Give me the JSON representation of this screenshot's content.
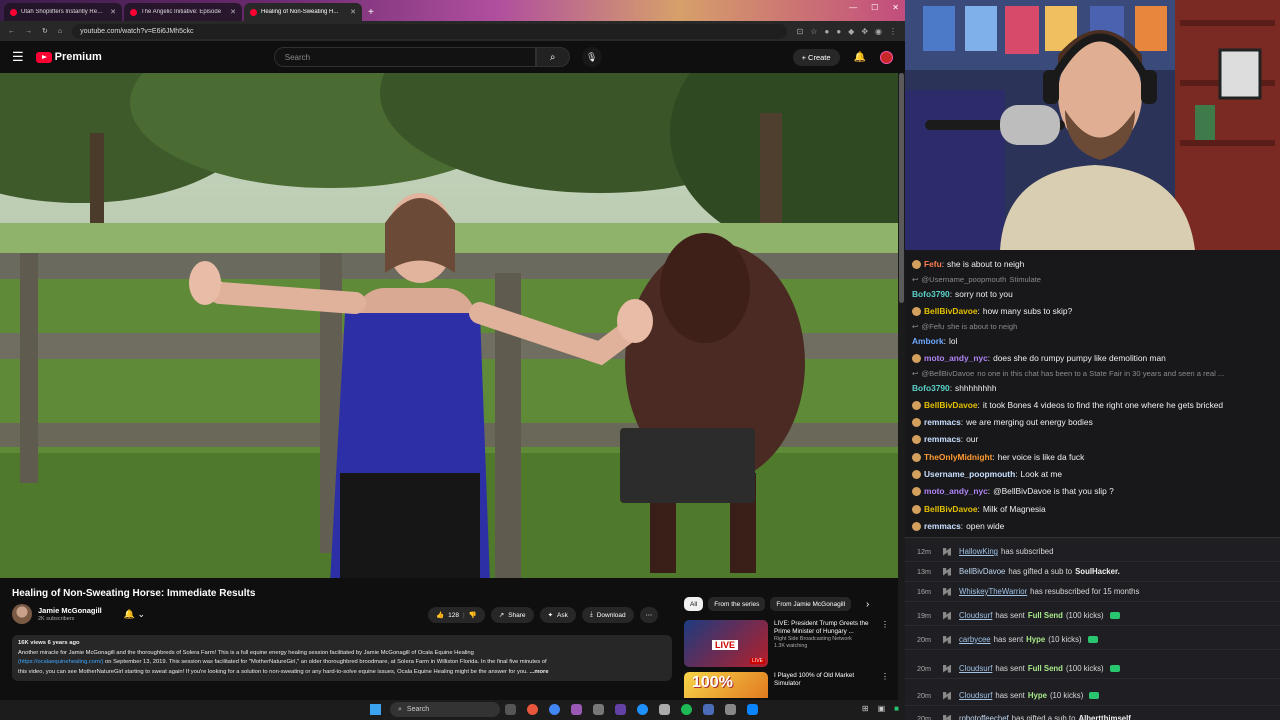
{
  "browser": {
    "tabs": [
      {
        "title": "Utah Shoplifters Instantly Regr...",
        "active": false
      },
      {
        "title": "The Angelic Initiative: Episode",
        "active": false
      },
      {
        "title": "Healing of Non-Sweating H...",
        "active": true
      }
    ],
    "url": "youtube.com/watch?v=E6i6JMh5ckc"
  },
  "youtube": {
    "logo_text": "Premium",
    "search_placeholder": "Search",
    "create_label": "Create",
    "video_title": "Healing of Non-Sweating Horse: Immediate Results",
    "channel_name": "Jamie McGonagill",
    "channel_subs": "2K subscribers",
    "likes": "128",
    "share_label": "Share",
    "ask_label": "Ask",
    "download_label": "Download",
    "description": {
      "meta": "16K views  6 years ago",
      "line1": "Another miracle for Jamie McGonagill and the thoroughbreds of Solera Farm! This is a full equine energy healing session facilitated by Jamie McGonagill of Ocala Equine Healing",
      "link": "(https://ocalaequinehealing.com/)",
      "line2": " on September 13, 2019. This session was facilitated for \"MotherNatureGirl,\" an older thoroughbred broodmare, at Solera Farm in Williston Florida. In the final five minutes of",
      "line3": "this video, you can see MotherNatureGirl starting to sweat again! If you're looking for a solution to non-sweating or any hard-to-solve equine issues, Ocala Equine Healing might be the answer for you.",
      "more": "...more"
    },
    "chips": [
      "All",
      "From the series",
      "From Jamie McGonagill"
    ],
    "recommendations": [
      {
        "title": "LIVE: President Trump Greets the Prime Minister of Hungary ...",
        "channel": "Right Side Broadcasting Network",
        "stats": "1.3K watching",
        "badge": "LIVE"
      },
      {
        "title": "I Played 100% of Old Market Simulator",
        "channel": "",
        "stats": "",
        "badge": "100%"
      }
    ]
  },
  "chat": {
    "messages": [
      {
        "user": "Fefu",
        "color": "#ff7f50",
        "text": "she is about to neigh",
        "badge": true,
        "reply": false
      },
      {
        "user": "@Username_poopmouth",
        "color": "#8a8a8f",
        "text": "Stimulate",
        "badge": false,
        "reply": true
      },
      {
        "user": "Bofo3790",
        "color": "#5ad1c8",
        "text": "sorry not to you",
        "badge": false,
        "reply": false
      },
      {
        "user": "BellBivDavoe",
        "color": "#e5c100",
        "text": "how many subs to skip?",
        "badge": true,
        "reply": false
      },
      {
        "user": "@Fefu",
        "color": "#8a8a8f",
        "text": "she is about to neigh",
        "badge": false,
        "reply": true
      },
      {
        "user": "Ambork",
        "color": "#6fa8ff",
        "text": "lol",
        "badge": false,
        "reply": false
      },
      {
        "user": "moto_andy_nyc",
        "color": "#b084f5",
        "text": "does she do rumpy pumpy like demolition man",
        "badge": true,
        "reply": false
      },
      {
        "user": "@BellBivDavoe",
        "color": "#8a8a8f",
        "text": "no one in this chat has been to a State Fair in 30 years and seen a real ...",
        "badge": false,
        "reply": true
      },
      {
        "user": "Bofo3790",
        "color": "#5ad1c8",
        "text": "shhhhhhhh",
        "badge": false,
        "reply": false
      },
      {
        "user": "BellBivDavoe",
        "color": "#e5c100",
        "text": "it took Bones 4 videos to find the right one where he gets bricked",
        "badge": true,
        "reply": false
      },
      {
        "user": "remmacs",
        "color": "#c8e0ff",
        "text": "we are merging out energy bodies",
        "badge": true,
        "reply": false
      },
      {
        "user": "remmacs",
        "color": "#c8e0ff",
        "text": "our",
        "badge": true,
        "reply": false
      },
      {
        "user": "TheOnlyMidnight",
        "color": "#ff9a2e",
        "text": "her voice is like da fuck",
        "badge": true,
        "reply": false
      },
      {
        "user": "Username_poopmouth",
        "color": "#c8e0ff",
        "text": "Look at me",
        "badge": true,
        "reply": false
      },
      {
        "user": "moto_andy_nyc",
        "color": "#b084f5",
        "text": "@BellBivDavoe is that you slip ?",
        "badge": true,
        "reply": false
      },
      {
        "user": "BellBivDavoe",
        "color": "#e5c100",
        "text": "Milk of Magnesia",
        "badge": true,
        "reply": false
      },
      {
        "user": "remmacs",
        "color": "#c8e0ff",
        "text": "open wide",
        "badge": true,
        "reply": false
      }
    ]
  },
  "events": [
    {
      "time": "12m",
      "user": "HallowKing",
      "pre": "has subscribed",
      "hl": "",
      "post": "",
      "bold": "",
      "gem": false,
      "underline": true
    },
    {
      "time": "13m",
      "user": "BellBivDavoe",
      "pre": "has gifted a sub to",
      "hl": "",
      "post": "",
      "bold": "SoulHacker.",
      "gem": false,
      "underline": false
    },
    {
      "time": "16m",
      "user": "WhiskeyTheWarrior",
      "pre": "has resubscribed for 15 months",
      "hl": "",
      "post": "",
      "bold": "",
      "gem": false,
      "underline": true
    },
    {
      "time": "19m",
      "user": "Cloudsurf",
      "pre": "has sent",
      "hl": "Full Send",
      "post": "(100 kicks)",
      "bold": "",
      "gem": true,
      "underline": true
    },
    {
      "time": "20m",
      "user": "carbycee",
      "pre": "has sent",
      "hl": "Hype",
      "post": "(10 kicks)",
      "bold": "",
      "gem": true,
      "underline": true
    },
    {
      "time": "20m",
      "user": "Cloudsurf",
      "pre": "has sent",
      "hl": "Full Send",
      "post": "(100 kicks)",
      "bold": "",
      "gem": true,
      "underline": true
    },
    {
      "time": "20m",
      "user": "Cloudsurf",
      "pre": "has sent",
      "hl": "Hype",
      "post": "(10 kicks)",
      "bold": "",
      "gem": true,
      "underline": true
    },
    {
      "time": "20m",
      "user": "robotoffeechef",
      "pre": "has gifted a sub to",
      "hl": "",
      "post": "",
      "bold": "Albertthimself",
      "gem": false,
      "underline": false
    }
  ],
  "taskbar": {
    "search_placeholder": "Search"
  }
}
